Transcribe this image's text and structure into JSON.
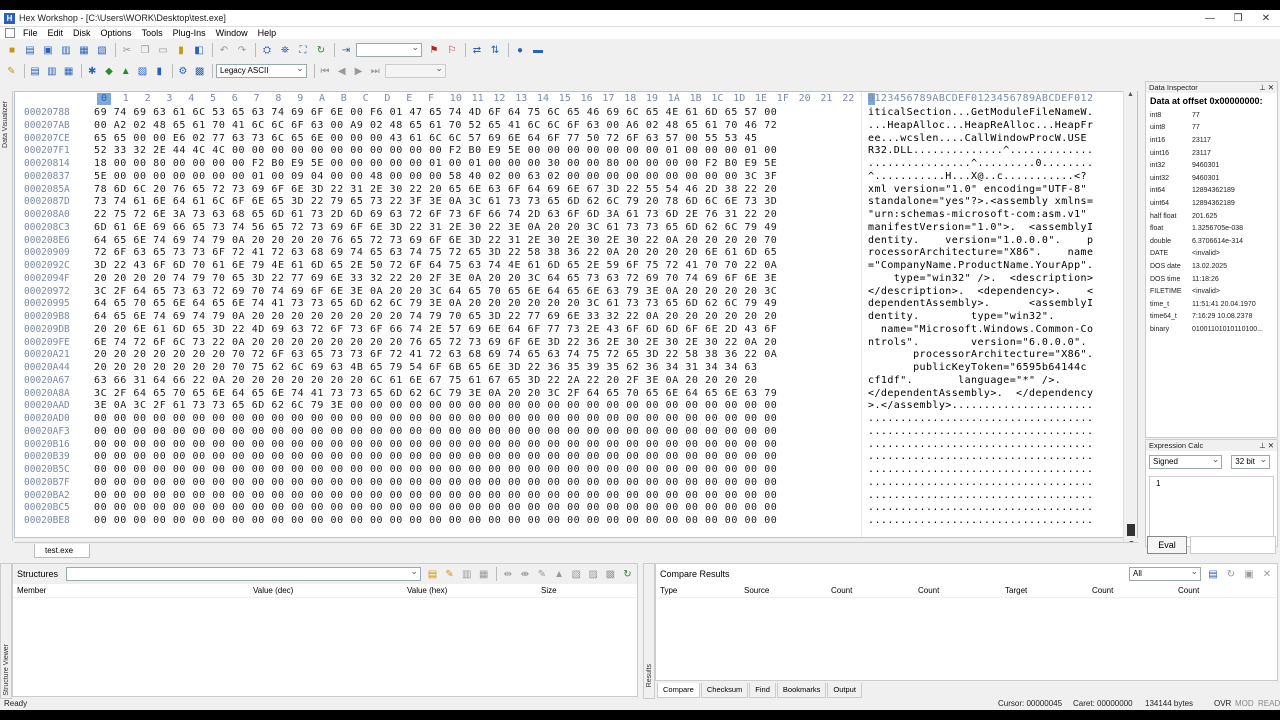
{
  "window": {
    "title": "Hex Workshop - [C:\\Users\\WORK\\Desktop\\test.exe]",
    "controls": [
      "—",
      "❐",
      "✕"
    ]
  },
  "menu": [
    "File",
    "Edit",
    "Disk",
    "Options",
    "Tools",
    "Plug-Ins",
    "Window",
    "Help"
  ],
  "toolbar2": {
    "encoding": "Legacy ASCII"
  },
  "hex": {
    "header_cols": [
      "0",
      "1",
      "2",
      "3",
      "4",
      "5",
      "6",
      "7",
      "8",
      "9",
      "A",
      "B",
      "C",
      "D",
      "E",
      "F",
      "10",
      "11",
      "12",
      "13",
      "14",
      "15",
      "16",
      "17",
      "18",
      "19",
      "1A",
      "1B",
      "1C",
      "1D",
      "1E",
      "1F",
      "20",
      "21",
      "22"
    ],
    "ascii_header": "0123456789ABCDEF0123456789ABCDEF012",
    "rows": [
      {
        "offset": "00020788",
        "hex": "69 74 69 63 61 6C 53 65 63 74 69 6F 6E 00 F6 01 47 65 74 4D 6F 64 75 6C 65 46 69 6C 65 4E 61 6D 65 57 00",
        "ascii": "iticalSection...GetModuleFileNameW."
      },
      {
        "offset": "000207AB",
        "hex": "00 A2 02 48 65 61 70 41 6C 6C 6F 63 00 A9 02 48 65 61 70 52 65 41 6C 6C 6F 63 00 A6 02 48 65 61 70 46 72",
        "ascii": "...HeapAlloc...HeapReAlloc...HeapFr"
      },
      {
        "offset": "000207CE",
        "hex": "65 65 00 00 E6 02 77 63 73 6C 65 6E 00 00 00 43 61 6C 6C 57 69 6E 64 6F 77 50 72 6F 63 57 00 55 53 45",
        "ascii": "ee...wcslen....CallWindowProcW.USE"
      },
      {
        "offset": "000207F1",
        "hex": "52 33 32 2E 44 4C 4C 00 00 00 00 00 00 00 00 00 00 00 F2 B0 E9 5E 00 00 00 00 00 00 00 01 00 00 00 01 00",
        "ascii": "R32.DLL..............^............."
      },
      {
        "offset": "00020814",
        "hex": "18 00 00 80 00 00 00 00 F2 B0 E9 5E 00 00 00 00 00 01 00 01 00 00 00 30 00 00 80 00 00 00 00 F2 B0 E9 5E",
        "ascii": "................^.........0........"
      },
      {
        "offset": "00020837",
        "hex": "5E 00 00 00 00 00 00 00 01 00 09 04 00 00 48 00 00 00 58 40 02 00 63 02 00 00 00 00 00 00 00 00 00 3C 3F",
        "ascii": "^...........H...X@..c...........<?"
      },
      {
        "offset": "0002085A",
        "hex": "78 6D 6C 20 76 65 72 73 69 6F 6E 3D 22 31 2E 30 22 20 65 6E 63 6F 64 69 6E 67 3D 22 55 54 46 2D 38 22 20",
        "ascii": "xml version=\"1.0\" encoding=\"UTF-8\" "
      },
      {
        "offset": "0002087D",
        "hex": "73 74 61 6E 64 61 6C 6F 6E 65 3D 22 79 65 73 22 3F 3E 0A 3C 61 73 73 65 6D 62 6C 79 20 78 6D 6C 6E 73 3D",
        "ascii": "standalone=\"yes\"?>.<assembly xmlns="
      },
      {
        "offset": "000208A0",
        "hex": "22 75 72 6E 3A 73 63 68 65 6D 61 73 2D 6D 69 63 72 6F 73 6F 66 74 2D 63 6F 6D 3A 61 73 6D 2E 76 31 22 20",
        "ascii": "\"urn:schemas-microsoft-com:asm.v1\" "
      },
      {
        "offset": "000208C3",
        "hex": "6D 61 6E 69 66 65 73 74 56 65 72 73 69 6F 6E 3D 22 31 2E 30 22 3E 0A 20 20 3C 61 73 73 65 6D 62 6C 79 49",
        "ascii": "manifestVersion=\"1.0\">.  <assemblyI"
      },
      {
        "offset": "000208E6",
        "hex": "64 65 6E 74 69 74 79 0A 20 20 20 20 76 65 72 73 69 6F 6E 3D 22 31 2E 30 2E 30 2E 30 22 0A 20 20 20 20 70",
        "ascii": "dentity.    version=\"1.0.0.0\".    p"
      },
      {
        "offset": "00020909",
        "hex": "72 6F 63 65 73 73 6F 72 41 72 63 68 69 74 65 63 74 75 72 65 3D 22 58 38 36 22 0A 20 20 20 20 6E 61 6D 65",
        "ascii": "rocessorArchitecture=\"X86\".    name"
      },
      {
        "offset": "0002092C",
        "hex": "3D 22 43 6F 6D 70 61 6E 79 4E 61 6D 65 2E 50 72 6F 64 75 63 74 4E 61 6D 65 2E 59 6F 75 72 41 70 70 22 0A",
        "ascii": "=\"CompanyName.ProductName.YourApp\"."
      },
      {
        "offset": "0002094F",
        "hex": "20 20 20 20 74 79 70 65 3D 22 77 69 6E 33 32 22 20 2F 3E 0A 20 20 3C 64 65 73 63 72 69 70 74 69 6F 6E 3E",
        "ascii": "    type=\"win32\" />.  <description>"
      },
      {
        "offset": "00020972",
        "hex": "3C 2F 64 65 73 63 72 69 70 74 69 6F 6E 3E 0A 20 20 3C 64 65 70 65 6E 64 65 6E 63 79 3E 0A 20 20 20 20 3C",
        "ascii": "</description>.  <dependency>.    <"
      },
      {
        "offset": "00020995",
        "hex": "64 65 70 65 6E 64 65 6E 74 41 73 73 65 6D 62 6C 79 3E 0A 20 20 20 20 20 20 3C 61 73 73 65 6D 62 6C 79 49",
        "ascii": "dependentAssembly>.      <assemblyI"
      },
      {
        "offset": "000209B8",
        "hex": "64 65 6E 74 69 74 79 0A 20 20 20 20 20 20 20 20 74 79 70 65 3D 22 77 69 6E 33 32 22 0A 20 20 20 20 20 20",
        "ascii": "dentity.        type=\"win32\".      "
      },
      {
        "offset": "000209DB",
        "hex": "20 20 6E 61 6D 65 3D 22 4D 69 63 72 6F 73 6F 66 74 2E 57 69 6E 64 6F 77 73 2E 43 6F 6D 6D 6F 6E 2D 43 6F",
        "ascii": "  name=\"Microsoft.Windows.Common-Co"
      },
      {
        "offset": "000209FE",
        "hex": "6E 74 72 6F 6C 73 22 0A 20 20 20 20 20 20 20 20 76 65 72 73 69 6F 6E 3D 22 36 2E 30 2E 30 2E 30 22 0A 20",
        "ascii": "ntrols\".        version=\"6.0.0.0\". "
      },
      {
        "offset": "00020A21",
        "hex": "20 20 20 20 20 20 20 70 72 6F 63 65 73 73 6F 72 41 72 63 68 69 74 65 63 74 75 72 65 3D 22 58 38 36 22 0A",
        "ascii": "       processorArchitecture=\"X86\"."
      },
      {
        "offset": "00020A44",
        "hex": "20 20 20 20 20 20 20 70 75 62 6C 69 63 4B 65 79 54 6F 6B 65 6E 3D 22 36 35 39 35 62 36 34 31 34 34 63",
        "ascii": "       publicKeyToken=\"6595b64144c"
      },
      {
        "offset": "00020A67",
        "hex": "63 66 31 64 66 22 0A 20 20 20 20 20 20 20 6C 61 6E 67 75 61 67 65 3D 22 2A 22 20 2F 3E 0A 20 20 20 20",
        "ascii": "cf1df\".       language=\"*\" />.    "
      },
      {
        "offset": "00020A8A",
        "hex": "3C 2F 64 65 70 65 6E 64 65 6E 74 41 73 73 65 6D 62 6C 79 3E 0A 20 20 3C 2F 64 65 70 65 6E 64 65 6E 63 79",
        "ascii": "</dependentAssembly>.  </dependency"
      },
      {
        "offset": "00020AAD",
        "hex": "3E 0A 3C 2F 61 73 73 65 6D 62 6C 79 3E 00 00 00 00 00 00 00 00 00 00 00 00 00 00 00 00 00 00 00 00 00 00",
        "ascii": ">.</assembly>......................"
      },
      {
        "offset": "00020AD0",
        "hex": "00 00 00 00 00 00 00 00 00 00 00 00 00 00 00 00 00 00 00 00 00 00 00 00 00 00 00 00 00 00 00 00 00 00 00",
        "ascii": "..................................."
      },
      {
        "offset": "00020AF3",
        "hex": "00 00 00 00 00 00 00 00 00 00 00 00 00 00 00 00 00 00 00 00 00 00 00 00 00 00 00 00 00 00 00 00 00 00 00",
        "ascii": "..................................."
      },
      {
        "offset": "00020B16",
        "hex": "00 00 00 00 00 00 00 00 00 00 00 00 00 00 00 00 00 00 00 00 00 00 00 00 00 00 00 00 00 00 00 00 00 00 00",
        "ascii": "..................................."
      },
      {
        "offset": "00020B39",
        "hex": "00 00 00 00 00 00 00 00 00 00 00 00 00 00 00 00 00 00 00 00 00 00 00 00 00 00 00 00 00 00 00 00 00 00 00",
        "ascii": "..................................."
      },
      {
        "offset": "00020B5C",
        "hex": "00 00 00 00 00 00 00 00 00 00 00 00 00 00 00 00 00 00 00 00 00 00 00 00 00 00 00 00 00 00 00 00 00 00 00",
        "ascii": "..................................."
      },
      {
        "offset": "00020B7F",
        "hex": "00 00 00 00 00 00 00 00 00 00 00 00 00 00 00 00 00 00 00 00 00 00 00 00 00 00 00 00 00 00 00 00 00 00 00",
        "ascii": "..................................."
      },
      {
        "offset": "00020BA2",
        "hex": "00 00 00 00 00 00 00 00 00 00 00 00 00 00 00 00 00 00 00 00 00 00 00 00 00 00 00 00 00 00 00 00 00 00 00",
        "ascii": "..................................."
      },
      {
        "offset": "00020BC5",
        "hex": "00 00 00 00 00 00 00 00 00 00 00 00 00 00 00 00 00 00 00 00 00 00 00 00 00 00 00 00 00 00 00 00 00 00 00",
        "ascii": "..................................."
      },
      {
        "offset": "00020BE8",
        "hex": "00 00 00 00 00 00 00 00 00 00 00 00 00 00 00 00 00 00 00 00 00 00 00 00 00 00 00 00 00 00 00 00 00 00 00",
        "ascii": "..................................."
      }
    ]
  },
  "file_tab": "test.exe",
  "data_inspector": {
    "title": "Data Inspector",
    "heading": "Data at offset 0x00000000:",
    "rows": [
      {
        "k": "int8",
        "v": "77"
      },
      {
        "k": "uint8",
        "v": "77"
      },
      {
        "k": "int16",
        "v": "23117"
      },
      {
        "k": "uint16",
        "v": "23117"
      },
      {
        "k": "int32",
        "v": "9460301"
      },
      {
        "k": "uint32",
        "v": "9460301"
      },
      {
        "k": "int64",
        "v": "12894362189"
      },
      {
        "k": "uint64",
        "v": "12894362189"
      },
      {
        "k": "half float",
        "v": "201.625"
      },
      {
        "k": "float",
        "v": "1.3256705e-038"
      },
      {
        "k": "double",
        "v": "6.3706614e-314"
      },
      {
        "k": "DATE",
        "v": "<invalid>"
      },
      {
        "k": "DOS date",
        "v": "13.02.2025"
      },
      {
        "k": "DOS time",
        "v": "11:18:26"
      },
      {
        "k": "FILETIME",
        "v": "<invalid>"
      },
      {
        "k": "time_t",
        "v": "11:51:41 20.04.1970"
      },
      {
        "k": "time64_t",
        "v": "7:16:29 10.08.2378"
      },
      {
        "k": "binary",
        "v": "01001101010110100..."
      }
    ]
  },
  "expression_calc": {
    "title": "Expression Calc",
    "sign": "Signed",
    "bits": "32 bit",
    "input": "1",
    "eval": "Eval"
  },
  "structures": {
    "title": "Structures",
    "cols": [
      "Member",
      "Value (dec)",
      "Value (hex)",
      "Size"
    ],
    "side_label": "Structure Viewer"
  },
  "compare": {
    "title": "Compare Results",
    "filter": "All",
    "cols": [
      "Type",
      "Source",
      "Count",
      "Count",
      "Target",
      "Count",
      "Count"
    ],
    "side_label": "Results",
    "tabs": [
      "Compare",
      "Checksum",
      "Find",
      "Bookmarks",
      "Output"
    ]
  },
  "left_tab": "Data Visualizer",
  "status": {
    "ready": "Ready",
    "cursor": "Cursor: 00000045",
    "caret": "Caret: 00000000",
    "size": "134144 bytes",
    "ovr": "OVR",
    "mod": "MOD",
    "read": "READ"
  }
}
